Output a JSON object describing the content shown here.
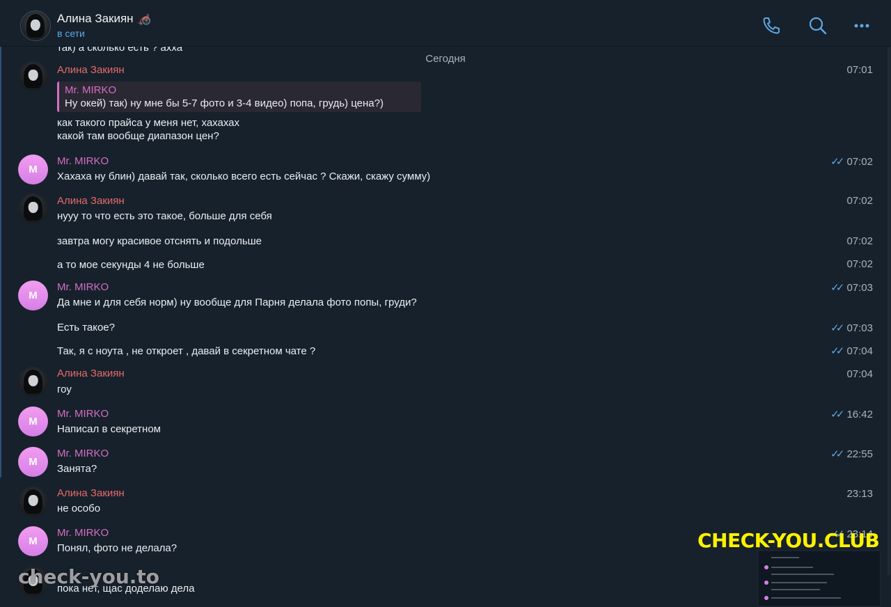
{
  "header": {
    "name": "Алина Закиян 🦽",
    "status": "в сети",
    "icons": [
      "phone-icon",
      "search-icon",
      "more-icon"
    ],
    "accent": "#5ea8e6"
  },
  "chat": {
    "prev_message": "так) а сколько есть ? ахха",
    "date_label": "Сегодня",
    "messages": [
      {
        "sender": "Алина Закиян",
        "reply_name": "Mr. MIRKO",
        "reply_text": "Ну окей) так) ну мне бы 5-7 фото и 3-4 видео) попа, грудь) цена?)",
        "lines": [
          "как такого прайса у меня нет, хахахах",
          "какой там вообще диапазон цен?"
        ],
        "time": "07:01"
      },
      {
        "sender": "Mr. MIRKO",
        "avatar_letter": "M",
        "text": "Хахаха ну блин) давай так, сколько всего есть сейчас ? Скажи, скажу сумму)",
        "time": "07:02"
      },
      {
        "sender": "Алина Закиян",
        "text": "нууу то что есть это такое, больше для себя",
        "time": "07:02"
      },
      {
        "text": "завтра могу красивое отснять и подольше",
        "time": "07:02"
      },
      {
        "text": "а то мое секунды 4 не больше",
        "time": "07:02"
      },
      {
        "sender": "Mr. MIRKO",
        "avatar_letter": "M",
        "text": "Да мне и для себя норм) ну вообще для Парня делала фото попы, груди?",
        "time": "07:03"
      },
      {
        "text": "Есть такое?",
        "time": "07:03"
      },
      {
        "text": "Так, я с ноута , не откроет , давай в секретном чате ?",
        "time": "07:04"
      },
      {
        "sender": "Алина Закиян",
        "text": "гоу",
        "time": "07:04"
      },
      {
        "sender": "Mr. MIRKO",
        "avatar_letter": "M",
        "text": "Написал в секретном",
        "time": "16:42"
      },
      {
        "sender": "Mr. MIRKO",
        "avatar_letter": "M",
        "text": "Занята?",
        "time": "22:55"
      },
      {
        "sender": "Алина Закиян",
        "text": "не особо",
        "time": "23:13"
      },
      {
        "sender": "Mr. MIRKO",
        "avatar_letter": "M",
        "text": "Понял, фото не делала?",
        "time": "23:14"
      },
      {
        "text": "пока нет, щас доделаю дела"
      }
    ]
  },
  "watermarks": {
    "top": "CHECK-YOU.CLUB",
    "bottom": "check-you.to"
  }
}
